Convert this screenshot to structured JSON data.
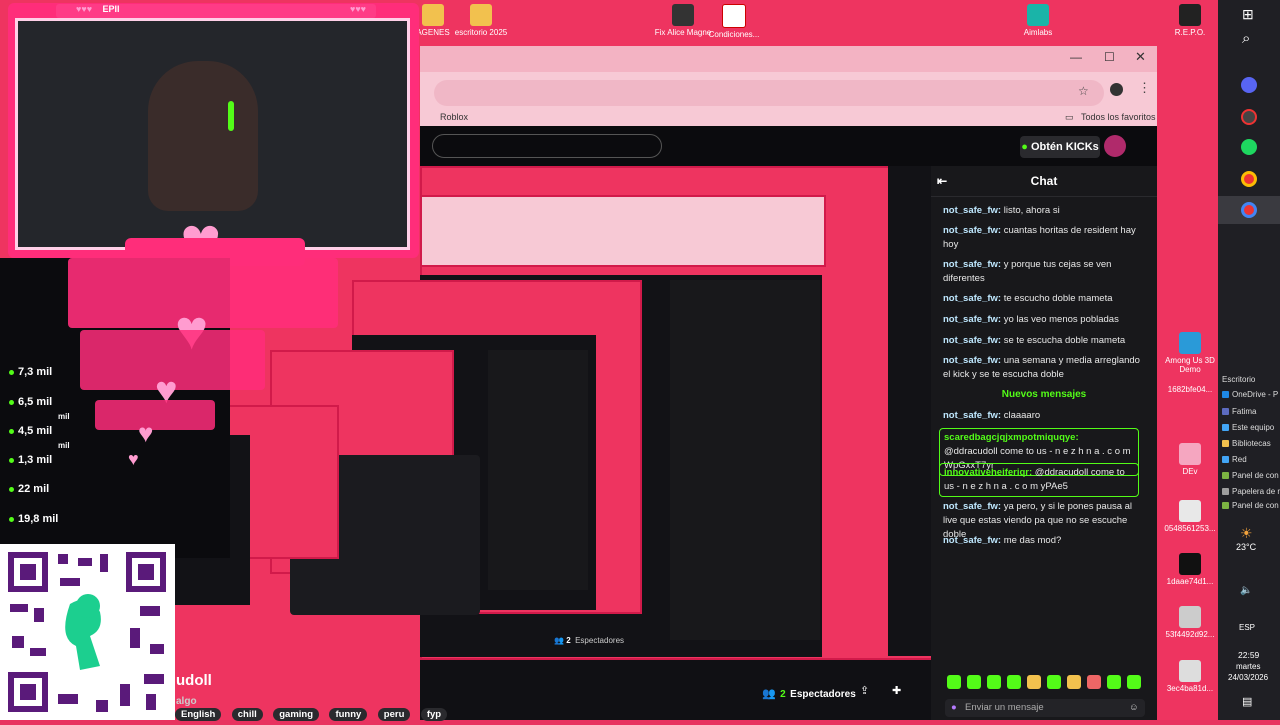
{
  "desktop_icons": [
    {
      "label": "AGENES",
      "color": "#f2c14e"
    },
    {
      "label": "escritorio 2025",
      "color": "#f2c14e"
    },
    {
      "label": "Fix Alice Magne",
      "color": "#333333"
    },
    {
      "label": "Condiciones...",
      "color": "#ffffff"
    },
    {
      "label": "Aimlabs",
      "color": "#1ab4a8"
    },
    {
      "label": "R.E.P.O.",
      "color": "#222222"
    },
    {
      "label": "Among Us 3D Demo",
      "color": "#2a9ad8"
    },
    {
      "label": "DEv",
      "color": "#f5a6c0"
    },
    {
      "label": "0548561253...",
      "color": "#e8e8e8"
    },
    {
      "label": "1daae74d1...",
      "color": "#111111"
    },
    {
      "label": "53f4492d92...",
      "color": "#cccccc"
    },
    {
      "label": "3ec4ba81d...",
      "color": "#dddddd"
    },
    {
      "label": "1682bfe04...",
      "color": "#eeeeee"
    }
  ],
  "browser": {
    "bookmark": "Roblox",
    "all_favorites": "Todos los favoritos",
    "kicks_button": "Obtén KICKs"
  },
  "chat": {
    "title": "Chat",
    "new_messages": "Nuevos mensajes",
    "input_placeholder": "Enviar un mensaje",
    "messages": [
      {
        "user": "not_safe_fw:",
        "text": " listo, ahora si"
      },
      {
        "user": "not_safe_fw:",
        "text": " cuantas horitas de resident hay hoy"
      },
      {
        "user": "not_safe_fw:",
        "text": " y porque tus cejas se ven diferentes"
      },
      {
        "user": "not_safe_fw:",
        "text": " te escucho doble mameta"
      },
      {
        "user": "not_safe_fw:",
        "text": " yo las veo menos pobladas"
      },
      {
        "user": "not_safe_fw:",
        "text": " se te escucha doble mameta"
      },
      {
        "user": "not_safe_fw:",
        "text": " una semana y media arreglando el kick y se te escucha doble"
      }
    ],
    "after_messages": [
      {
        "user": "not_safe_fw:",
        "text": " claaaaro",
        "highlight": false
      },
      {
        "user": "scaredbagcjqjxmpotmiquqye:",
        "text": " @ddracudoll come to us - n e z h n a . c o m WpGxxT7yr",
        "highlight": true
      },
      {
        "user": "innovativeheiferiqr:",
        "text": " @ddracudoll come to us - n e z h n a . c o m yPAe5",
        "highlight": true
      },
      {
        "user": "not_safe_fw:",
        "text": " ya pero, y si le pones pausa al live que estas viendo pa que no se escuche doble",
        "highlight": false
      },
      {
        "user": "not_safe_fw:",
        "text": " me das mod?",
        "highlight": false
      }
    ]
  },
  "stream": {
    "spectators_count": "2",
    "spectators_label": "Espectadores",
    "streamer_partial": "udoll",
    "subtitle_partial": "algo",
    "tags": [
      "English",
      "chill",
      "gaming",
      "funny",
      "peru",
      "fyp"
    ]
  },
  "webcam": {
    "title": "EPII"
  },
  "stats": [
    "7,3 mil",
    "6,5 mil",
    "4,5 mil",
    "1,3 mil",
    "22 mil",
    "19,8 mil"
  ],
  "stats_suffix": "mil",
  "taskbar": {
    "explorer_header": "Escritorio",
    "explorer_items": [
      {
        "label": "OneDrive - P",
        "color": "#1e88e5"
      },
      {
        "label": "Fatima",
        "color": "#5c6bc0"
      },
      {
        "label": "Este equipo",
        "color": "#42a5f5"
      },
      {
        "label": "Bibliotecas",
        "color": "#f2c14e"
      },
      {
        "label": "Red",
        "color": "#42a5f5"
      },
      {
        "label": "Panel de con",
        "color": "#7cb342"
      },
      {
        "label": "Papelera de r",
        "color": "#9e9e9e"
      },
      {
        "label": "Panel de con",
        "color": "#7cb342"
      }
    ],
    "temperature": "23°C",
    "language": "ESP",
    "time": "22:59",
    "day": "martes",
    "date": "24/03/2026"
  }
}
